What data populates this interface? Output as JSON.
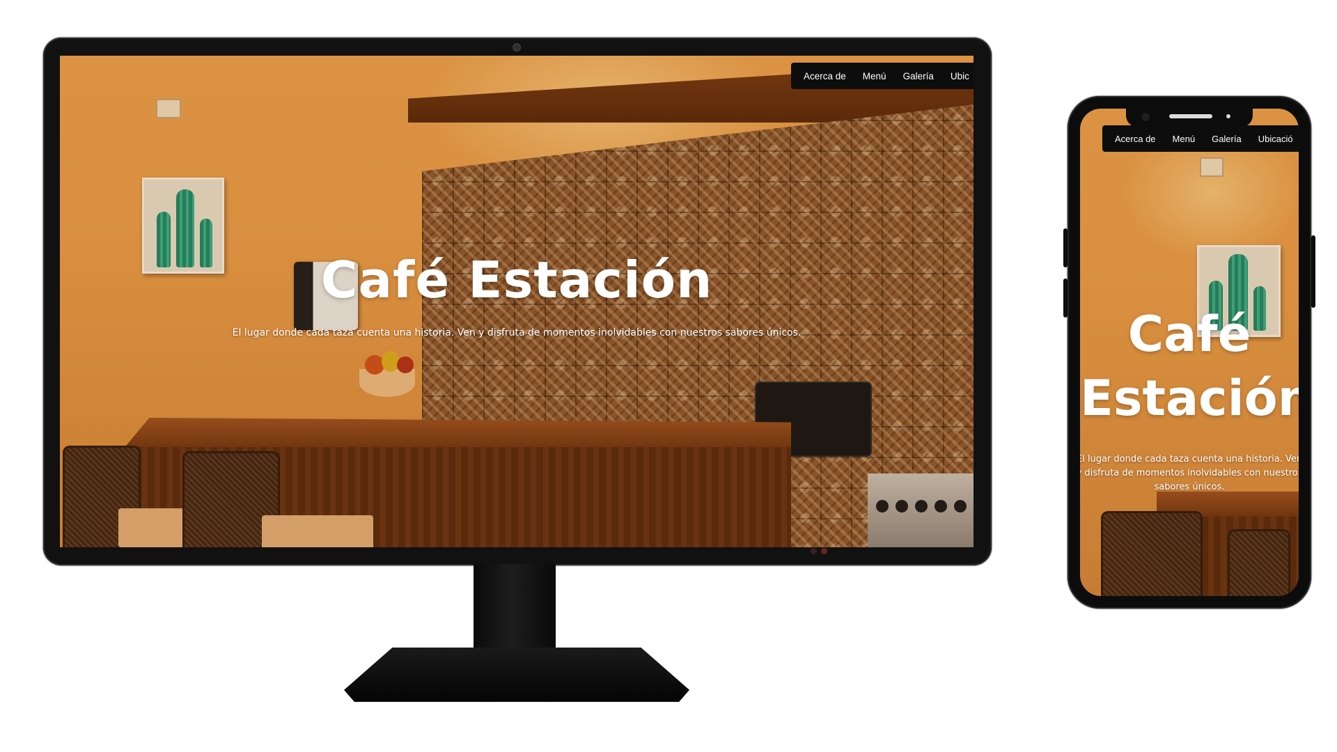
{
  "nav": {
    "items": [
      {
        "label": "Acerca de"
      },
      {
        "label": "Menú"
      },
      {
        "label": "Galería"
      },
      {
        "label": "Ubicación"
      }
    ],
    "desktop_visible": [
      "Acerca de",
      "Menú",
      "Galería",
      "Ubic"
    ],
    "mobile_visible": [
      "Acerca de",
      "Menú",
      "Galería",
      "Ubicació"
    ]
  },
  "hero": {
    "title": "Café Estación",
    "subtitle": "El lugar donde cada taza cuenta una historia. Ven y disfruta de momentos inolvidables con nuestros sabores únicos."
  },
  "colors": {
    "nav_bg": "#0d0d0d",
    "nav_text": "#ffffff",
    "wall": "#f0a44e",
    "wood": "#733711",
    "device_frame": "#111111"
  }
}
